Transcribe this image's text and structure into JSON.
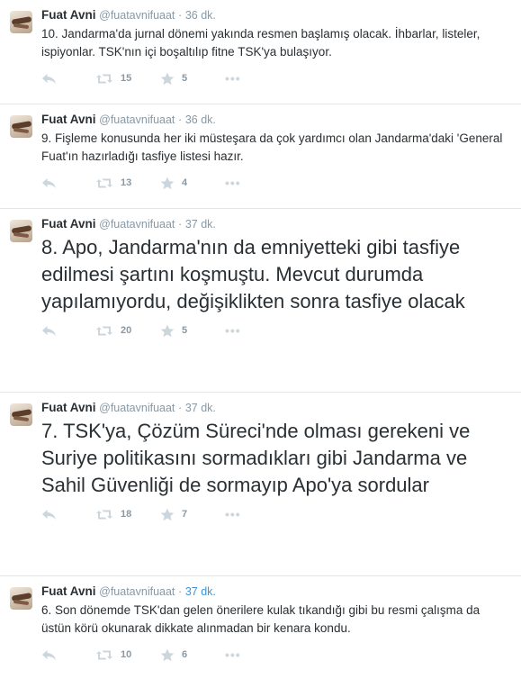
{
  "colors": {
    "text": "#292f33",
    "muted": "#8899a6",
    "icon": "#ccd6dd",
    "link_blue": "#3b94d9",
    "divider": "#e1e8ed"
  },
  "tweets": [
    {
      "name": "Fuat Avni",
      "handle": "@fuatavnifuaat",
      "dot": "·",
      "time": "36 dk.",
      "text": "10. Jandarma'da jurnal dönemi yakında resmen başlamış olacak. İhbarlar, listeler, ispiyonlar. TSK'nın içi boşaltılıp fitne TSK'ya bulaşıyor.",
      "retweets": "15",
      "favorites": "5",
      "more": "•••"
    },
    {
      "name": "Fuat Avni",
      "handle": "@fuatavnifuaat",
      "dot": "·",
      "time": "36 dk.",
      "text": "9. Fişleme konusunda her iki müsteşara da çok yardımcı olan Jandarma'daki 'General Fuat'ın hazırladığı tasfiye listesi hazır.",
      "retweets": "13",
      "favorites": "4",
      "more": "•••"
    },
    {
      "name": "Fuat Avni",
      "handle": "@fuatavnifuaat",
      "dot": "·",
      "time": "37 dk.",
      "text": "8. Apo, Jandarma'nın da emniyetteki gibi tasfiye edilmesi şartını koşmuştu. Mevcut durumda yapılamıyordu, değişiklikten sonra tasfiye olacak",
      "retweets": "20",
      "favorites": "5",
      "more": "•••"
    },
    {
      "name": "Fuat Avni",
      "handle": "@fuatavnifuaat",
      "dot": "·",
      "time": "37 dk.",
      "text": "7. TSK'ya, Çözüm Süreci'nde olması gerekeni ve Suriye politikasını sormadıkları gibi Jandarma ve Sahil Güvenliği de sormayıp Apo'ya sordular",
      "retweets": "18",
      "favorites": "7",
      "more": "•••"
    },
    {
      "name": "Fuat Avni",
      "handle": "@fuatavnifuaat",
      "dot": "·",
      "time": "37 dk.",
      "text": "6. Son dönemde TSK'dan gelen önerilere kulak tıkandığı gibi bu resmi çalışma da üstün körü okunarak dikkate alınmadan bir kenara kondu.",
      "retweets": "10",
      "favorites": "6",
      "more": "•••"
    }
  ]
}
